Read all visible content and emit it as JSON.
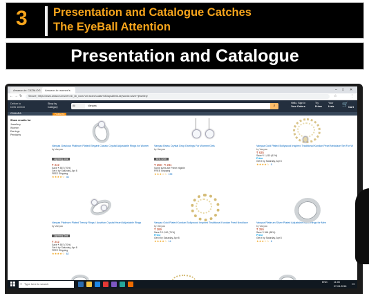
{
  "slide": {
    "number": "3",
    "headline_line1": "Presentation and Catalogue Catches",
    "headline_line2": "The EyeBall Attention",
    "section_title": "Presentation and Catalogue"
  },
  "browser": {
    "tabs": [
      "Amazon.in: CATALOG",
      "Amazon.in: women's"
    ],
    "url": "Secure | https://www.amazon.in/s/ref=nb_sb_noss?url=search-alias%3Daps&field-keywords=silver+jewellery",
    "window_controls": [
      "–",
      "□",
      "✕"
    ]
  },
  "amazon": {
    "deliver_line1": "Deliver to",
    "deliver_line2": "Delhi 110043",
    "shop_by_line1": "Shop by",
    "shop_by_line2": "Category",
    "search_dept": "All",
    "search_query": "Vanyaa",
    "account_line1": "Hello, Sign in",
    "account_line2": "Your Orders",
    "try_line1": "Try",
    "try_line2": "Prime",
    "lists_line1": "Your",
    "lists_line2": "Lists",
    "cart_label": "Cart",
    "subnav": "GIVAARA",
    "sort_badge": "Featured"
  },
  "filters": {
    "heading": "Show results for",
    "items": [
      "Jewellery",
      "Women",
      "Earrings",
      "Pendants"
    ]
  },
  "products": [
    {
      "title": "Vanyaa Gracious Platinum Plated Elegant Classic Crystal Adjustable Rings for Women",
      "brand": "by Vanyaa",
      "badge": "Lightning Deal",
      "price": "₹ 242",
      "info1": "Save ₹ 557 (70%)",
      "info2": "Get it by Saturday, Apr 8",
      "info3": "FREE Shipping",
      "stars": "★★★★☆",
      "reviews": "46"
    },
    {
      "title": "Vanyaa Brass Crystal Drop Earrings For Women/Girls",
      "brand": "by Vanyaa",
      "badge": "Best Seller",
      "price": "₹ 259 - ₹ 281",
      "info1": "Some sizes are Prime eligible",
      "info2": "FREE Shipping",
      "info3": "",
      "stars": "★★★☆☆",
      "reviews": "199"
    },
    {
      "title": "Vanyaa Gold Plated Bollywood Inspired Traditional Kundan Pearl Necklace Set For Women with Earrings",
      "brand": "by Vanyaa",
      "badge": "",
      "price": "₹ 635",
      "info1": "Save ₹ 1,010 (61%)",
      "info2": "Prime",
      "info3": "Get it by Saturday, Apr 8",
      "stars": "★★★★☆",
      "reviews": "9"
    },
    {
      "title": "Vanyaa Platinum Plated Trendy Rings / Austrian Crystal Heart Adjustable Rings",
      "brand": "by Vanyaa",
      "badge": "Lightning Deal",
      "price": "₹ 242",
      "info1": "Save ₹ 557 (70%)",
      "info2": "Get it by Saturday, Apr 8",
      "info3": "FREE Shipping",
      "stars": "★★★★☆",
      "reviews": "62"
    },
    {
      "title": "Vanyaa Gold Plated Kundan Bollywood Inspired Traditional Kundan Pearl Necklace",
      "brand": "by Vanyaa",
      "badge": "",
      "price": "₹ 389",
      "info1": "Save ₹ 1,010 (71%)",
      "info2": "Prime",
      "info3": "Get it by Saturday, Apr 8",
      "stars": "★★★★☆",
      "reviews": "14"
    },
    {
      "title": "Vanyaa Platinum Silver Plated Adjustable Band Rings for Men",
      "brand": "by Vanyaa",
      "badge": "",
      "price": "₹ 255",
      "info1": "Save ₹ 544 (68%)",
      "info2": "Prime",
      "info3": "Get it by Saturday, Apr 8",
      "stars": "★★★☆☆",
      "reviews": "6"
    }
  ],
  "taskbar": {
    "search_placeholder": "Type here to search",
    "time": "11:05",
    "date": "07-04-2018",
    "lang": "ENG"
  }
}
